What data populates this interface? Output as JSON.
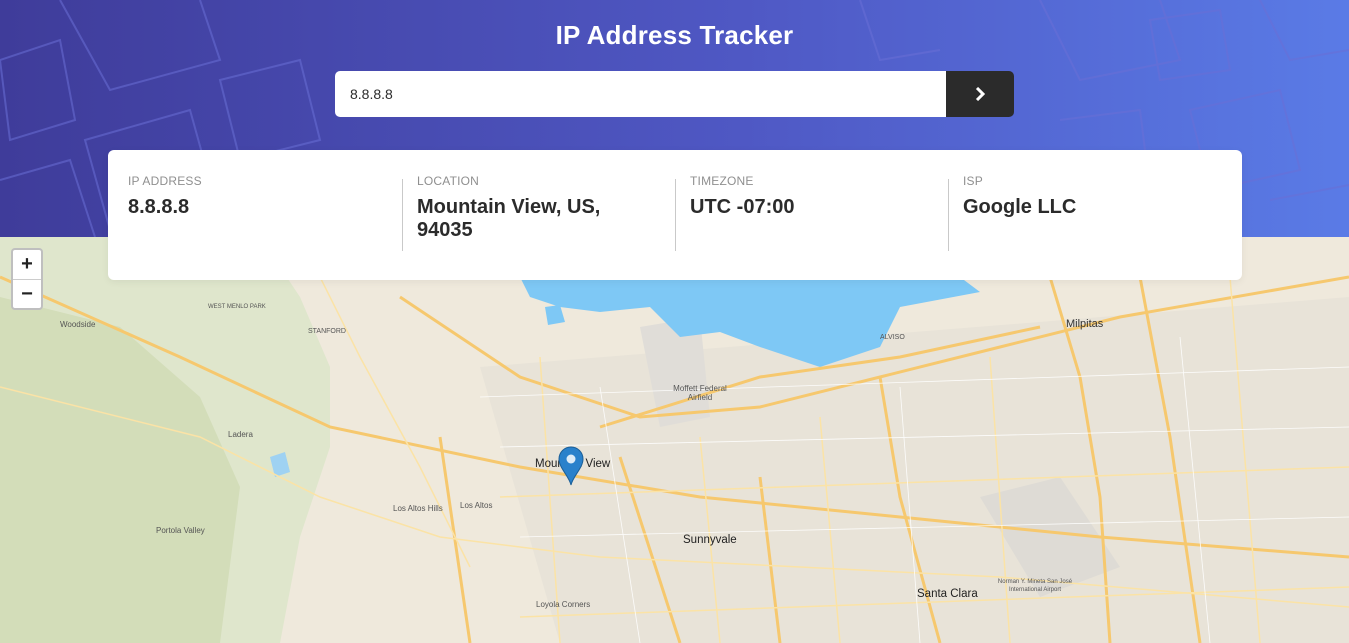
{
  "header": {
    "title": "IP Address Tracker",
    "gradient": [
      "#3f3c9a",
      "#5a7be6"
    ]
  },
  "search": {
    "value": "8.8.8.8",
    "submit_icon": "chevron-right-icon"
  },
  "info": {
    "ip": {
      "label": "IP ADDRESS",
      "value": "8.8.8.8"
    },
    "location": {
      "label": "LOCATION",
      "value": "Mountain View, US, 94035"
    },
    "timezone": {
      "label": "TIMEZONE",
      "value": "UTC -07:00"
    },
    "isp": {
      "label": "ISP",
      "value": "Google LLC"
    }
  },
  "map": {
    "zoom_in": "+",
    "zoom_out": "−",
    "water_color": "#7ec8f5",
    "marker_color": "#2a81cb",
    "labels": {
      "milpitas": "Milpitas",
      "woodside": "Woodside",
      "ladera": "Ladera",
      "mountain_view": "Mountain View",
      "los_altos_hills": "Los Altos Hills",
      "los_altos": "Los Altos",
      "portola_valley": "Portola Valley",
      "sunnyvale": "Sunnyvale",
      "santa_clara": "Santa Clara",
      "loyola_corners": "Loyola Corners",
      "moffett": "Moffett Federal Airfield",
      "stanford": "STANFORD",
      "west_menlo_park": "WEST MENLO PARK",
      "alviso": "ALVISO",
      "san_jose_airport": "Norman Y. Mineta San José International Airport"
    }
  }
}
